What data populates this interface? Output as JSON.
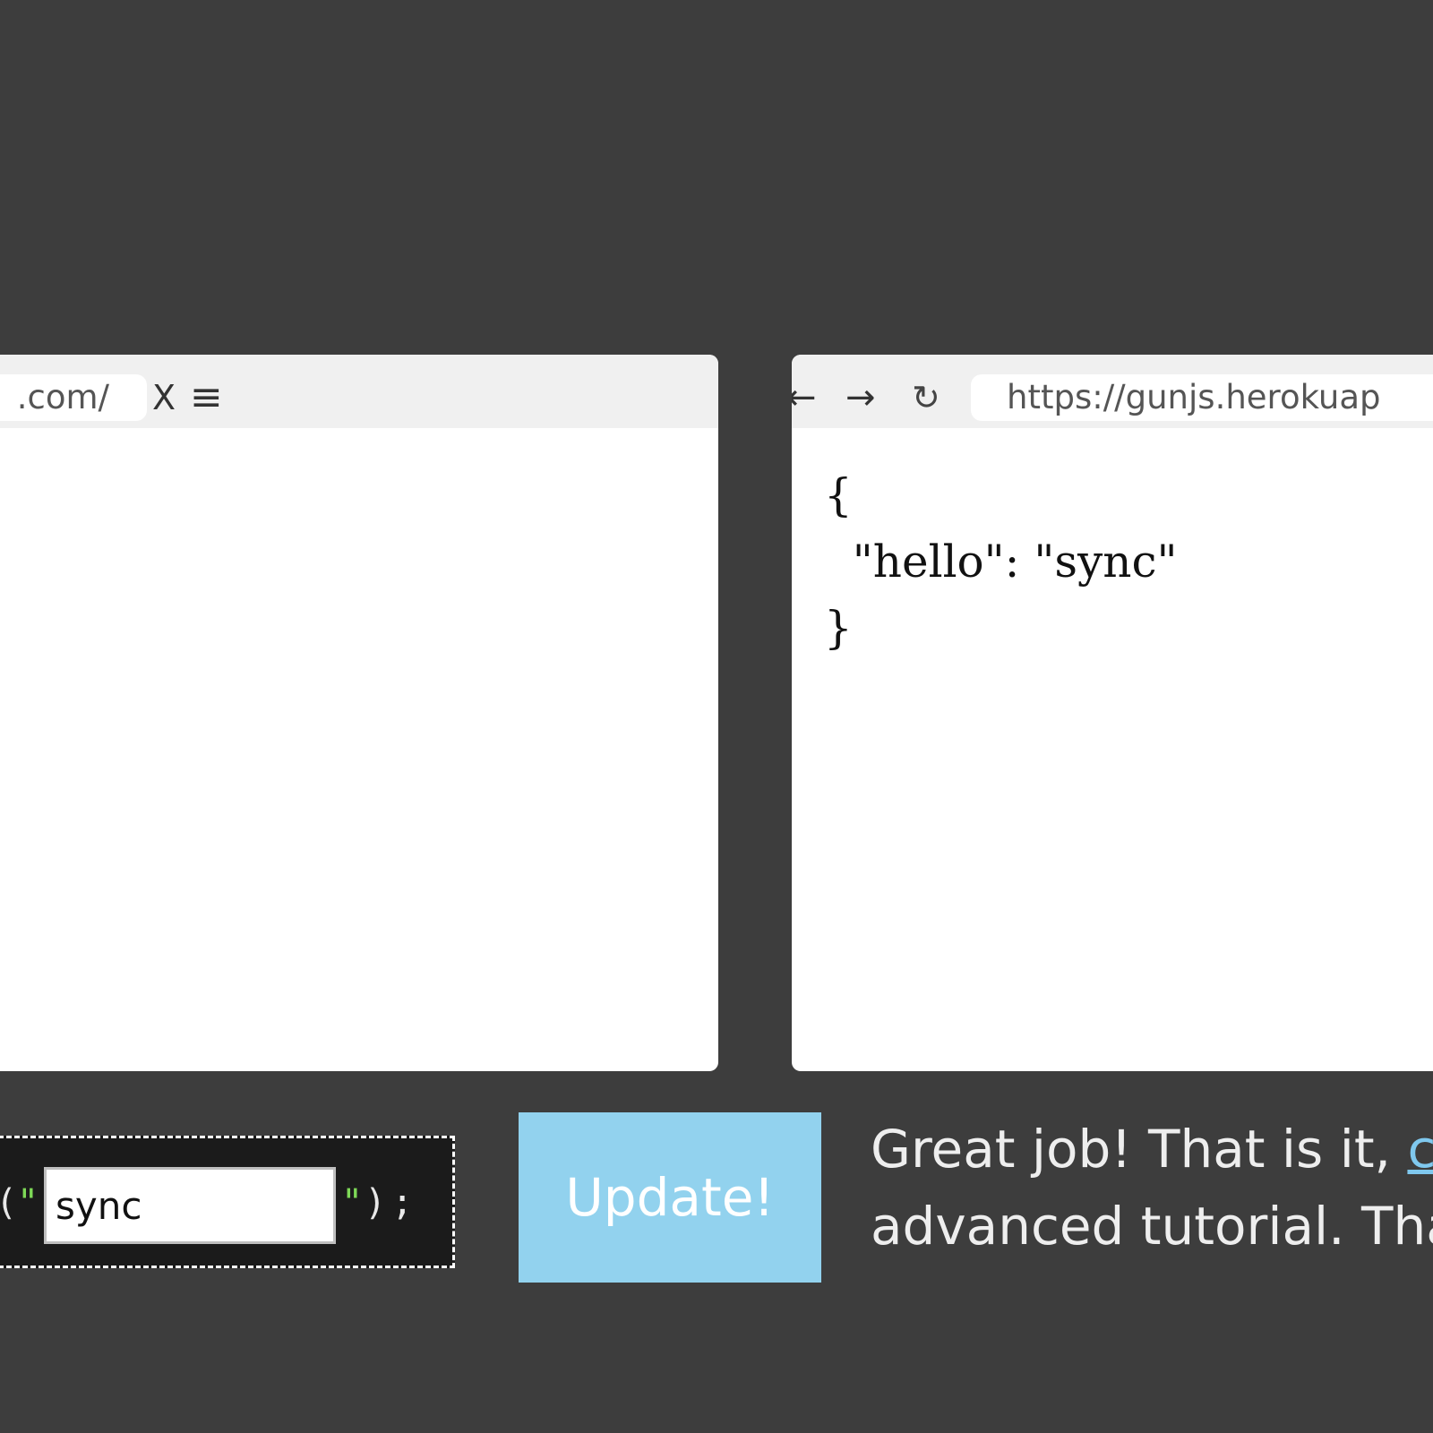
{
  "left_browser": {
    "url": ".com/",
    "close_label": "X",
    "menu_icon": "≡"
  },
  "right_browser": {
    "back_icon": "←",
    "forward_icon": "→",
    "reload_icon": "↻",
    "url": "https://gunjs.herokuap",
    "json_content": "{\n  \"hello\": \"sync\"\n}"
  },
  "code_editor": {
    "open_paren": "(",
    "open_quote": "\"",
    "input_value": "sync",
    "close_quote": "\"",
    "close_rest": ");"
  },
  "update_button": {
    "label": "Update!"
  },
  "message": {
    "line1_text": "Great job! That is it, ",
    "link_text": "cl",
    "line2_text": "advanced tutorial. Tha"
  },
  "colors": {
    "background": "#3d3d3d",
    "update_button": "#92d2ee",
    "code_quote": "#7ed957",
    "link": "#7fc8ee"
  }
}
